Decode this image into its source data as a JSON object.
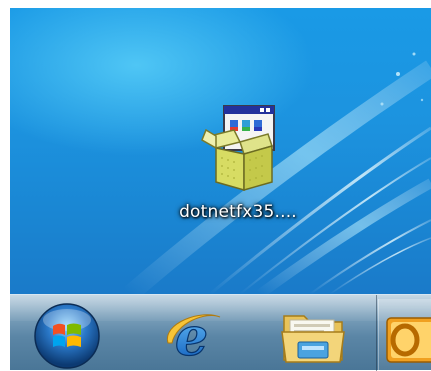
{
  "desktop": {
    "icons": [
      {
        "label": "dotnetfx35....",
        "icon": "installer-package-icon"
      }
    ]
  },
  "taskbar": {
    "items": [
      {
        "name": "start-button",
        "icon": "windows-orb-icon"
      },
      {
        "name": "internet-explorer",
        "icon": "internet-explorer-icon"
      },
      {
        "name": "windows-explorer",
        "icon": "folder-library-icon"
      },
      {
        "name": "outlook",
        "icon": "outlook-icon"
      }
    ]
  },
  "colors": {
    "desktop_blue": "#1a8fdc",
    "taskbar": "#5b86a6",
    "label_text": "#ffffff"
  }
}
